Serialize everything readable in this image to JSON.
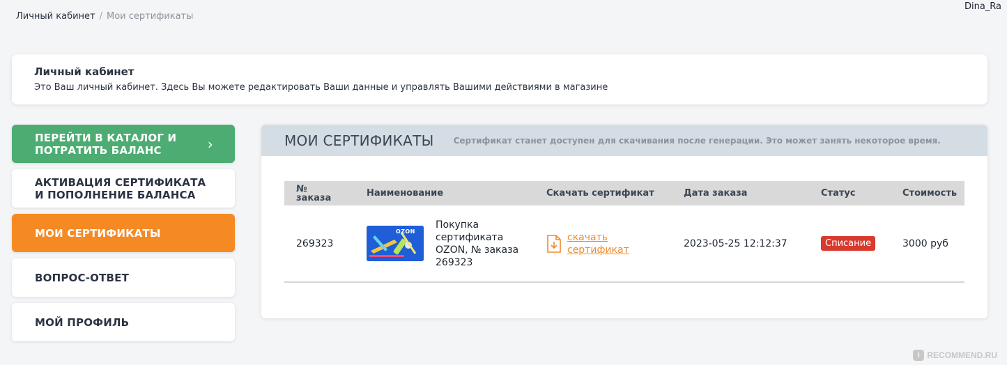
{
  "breadcrumb": {
    "home": "Личный кабинет",
    "separator": "/",
    "current": "Мои сертификаты"
  },
  "user": {
    "name": "Dina_Ra"
  },
  "intro": {
    "title": "Личный кабинет",
    "description": "Это Ваш личный кабинет. Здесь Вы можете редактировать Ваши данные и управлять Вашими действиями в магазине"
  },
  "sidebar": {
    "items": [
      {
        "label": "ПЕРЕЙТИ В КАТАЛОГ И ПОТРАТИТЬ БАЛАНС",
        "line1": "ПЕРЕЙТИ В КАТАЛОГ И",
        "line2": "ПОТРАТИТЬ БАЛАНС",
        "icon": "chevron-right-icon"
      },
      {
        "label": "АКТИВАЦИЯ СЕРТИФИКАТА И ПОПОЛНЕНИЕ БАЛАНСА",
        "line1": "АКТИВАЦИЯ СЕРТИФИКАТА",
        "line2": "И ПОПОЛНЕНИЕ БАЛАНСА"
      },
      {
        "label": "МОИ СЕРТИФИКАТЫ"
      },
      {
        "label": "ВОПРОС-ОТВЕТ"
      },
      {
        "label": "МОЙ ПРОФИЛЬ"
      }
    ]
  },
  "panel": {
    "title": "МОИ СЕРТИФИКАТЫ",
    "note": "Сертификат станет доступен для скачивания после генерации. Это может занять некоторое время."
  },
  "table": {
    "headers": {
      "order_no_line1": "№",
      "order_no_line2": "заказа",
      "name": "Наименование",
      "download": "Скачать сертификат",
      "date": "Дата заказа",
      "status": "Статус",
      "price": "Стоимость"
    },
    "rows": [
      {
        "order_no": "269323",
        "card_logo": "OZON",
        "name": "Покупка сертификата OZON, № заказа 269323",
        "download_line1": "скачать",
        "download_line2": "сертификат",
        "date": "2023-05-25 12:12:37",
        "status": "Списание",
        "price": "3000 руб"
      }
    ]
  },
  "watermark": {
    "text": "RECOMMEND.RU",
    "badge": "i"
  },
  "colors": {
    "green": "#4cac72",
    "orange": "#f58a24",
    "status_red": "#d83a2d",
    "panel_head": "#d5dde4",
    "link": "#f08a28"
  }
}
